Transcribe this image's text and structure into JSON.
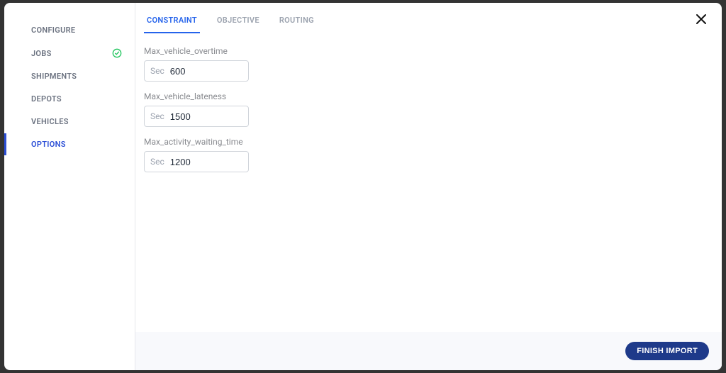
{
  "sidebar": {
    "items": [
      {
        "label": "CONFIGURE",
        "active": false,
        "check": false
      },
      {
        "label": "JOBS",
        "active": false,
        "check": true
      },
      {
        "label": "SHIPMENTS",
        "active": false,
        "check": false
      },
      {
        "label": "DEPOTS",
        "active": false,
        "check": false
      },
      {
        "label": "VEHICLES",
        "active": false,
        "check": false
      },
      {
        "label": "OPTIONS",
        "active": true,
        "check": false
      }
    ]
  },
  "tabs": [
    {
      "label": "CONSTRAINT",
      "active": true
    },
    {
      "label": "OBJECTIVE",
      "active": false
    },
    {
      "label": "ROUTING",
      "active": false
    }
  ],
  "fields": {
    "overtime": {
      "label": "Max_vehicle_overtime",
      "prefix": "Sec",
      "value": "600"
    },
    "lateness": {
      "label": "Max_vehicle_lateness",
      "prefix": "Sec",
      "value": "1500"
    },
    "waiting": {
      "label": "Max_activity_waiting_time",
      "prefix": "Sec",
      "value": "1200"
    }
  },
  "footer": {
    "finish_label": "FINISH IMPORT"
  },
  "colors": {
    "accent": "#2563eb",
    "button": "#1e3a8a",
    "check": "#22c55e"
  }
}
